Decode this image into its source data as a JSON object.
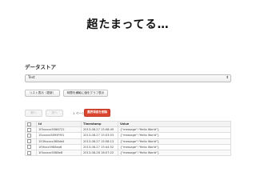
{
  "slide": {
    "title": "超たまってる…"
  },
  "section": {
    "title": "データストア"
  },
  "kind_select": {
    "selected": "Test"
  },
  "toolbar": {
    "list_button": "リスト表示（更新）",
    "graph_button": "時間を横軸に値をグラフ表示",
    "prev_button": "前へ",
    "next_button": "次へ",
    "page_label": "1 ページ目",
    "delete_button": "選択項目を削除"
  },
  "table": {
    "headers": [
      "",
      "Id",
      "Timestamp",
      "Value"
    ],
    "rows": [
      {
        "id": "1f3xxxxx5588722",
        "timestamp": "2013-08-27 15:08:49",
        "value": "{\"message\":\"Hello World\"}"
      },
      {
        "id": "15xxxxx5895F6f1",
        "timestamp": "2013-08-27 15:03:03",
        "value": "{\"message\":\"Hello World\"}"
      },
      {
        "id": "153fxxxxx388dd4",
        "timestamp": "2013-08-27 15:58:13",
        "value": "{\"message\":\"Hello World\"}"
      },
      {
        "id": "1f5fxxx5988ea6",
        "timestamp": "2013-08-27 15:44:52",
        "value": "{\"message\":\"Hello World\"}"
      },
      {
        "id": "1f3xxxxx5588e8",
        "timestamp": "2013-08-28 16:07:22",
        "value": "{\"message\":\"Hello World\"}"
      }
    ]
  }
}
